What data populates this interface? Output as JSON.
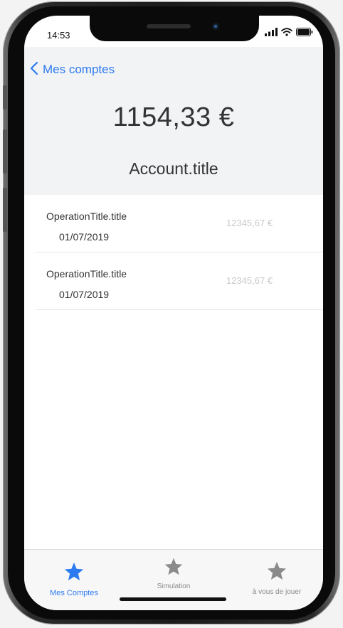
{
  "status_bar": {
    "time": "14:53"
  },
  "nav": {
    "back_label": "Mes comptes"
  },
  "account": {
    "balance": "1154,33 €",
    "title": "Account.title"
  },
  "operations": [
    {
      "title": "OperationTitle.title",
      "date": "01/07/2019",
      "amount": "12345,67 €"
    },
    {
      "title": "OperationTitle.title",
      "date": "01/07/2019",
      "amount": "12345,67 €"
    }
  ],
  "tabs": [
    {
      "label": "Mes Comptes",
      "icon": "star-icon",
      "active": true
    },
    {
      "label": "Simulation",
      "icon": "star-icon",
      "active": false
    },
    {
      "label": "à vous de jouer",
      "icon": "star-icon",
      "active": false
    }
  ],
  "colors": {
    "accent": "#2d7bf0",
    "header_bg": "#f2f3f5",
    "inactive_icon": "#8a8a8a",
    "amount_text": "#c9c9c9"
  }
}
